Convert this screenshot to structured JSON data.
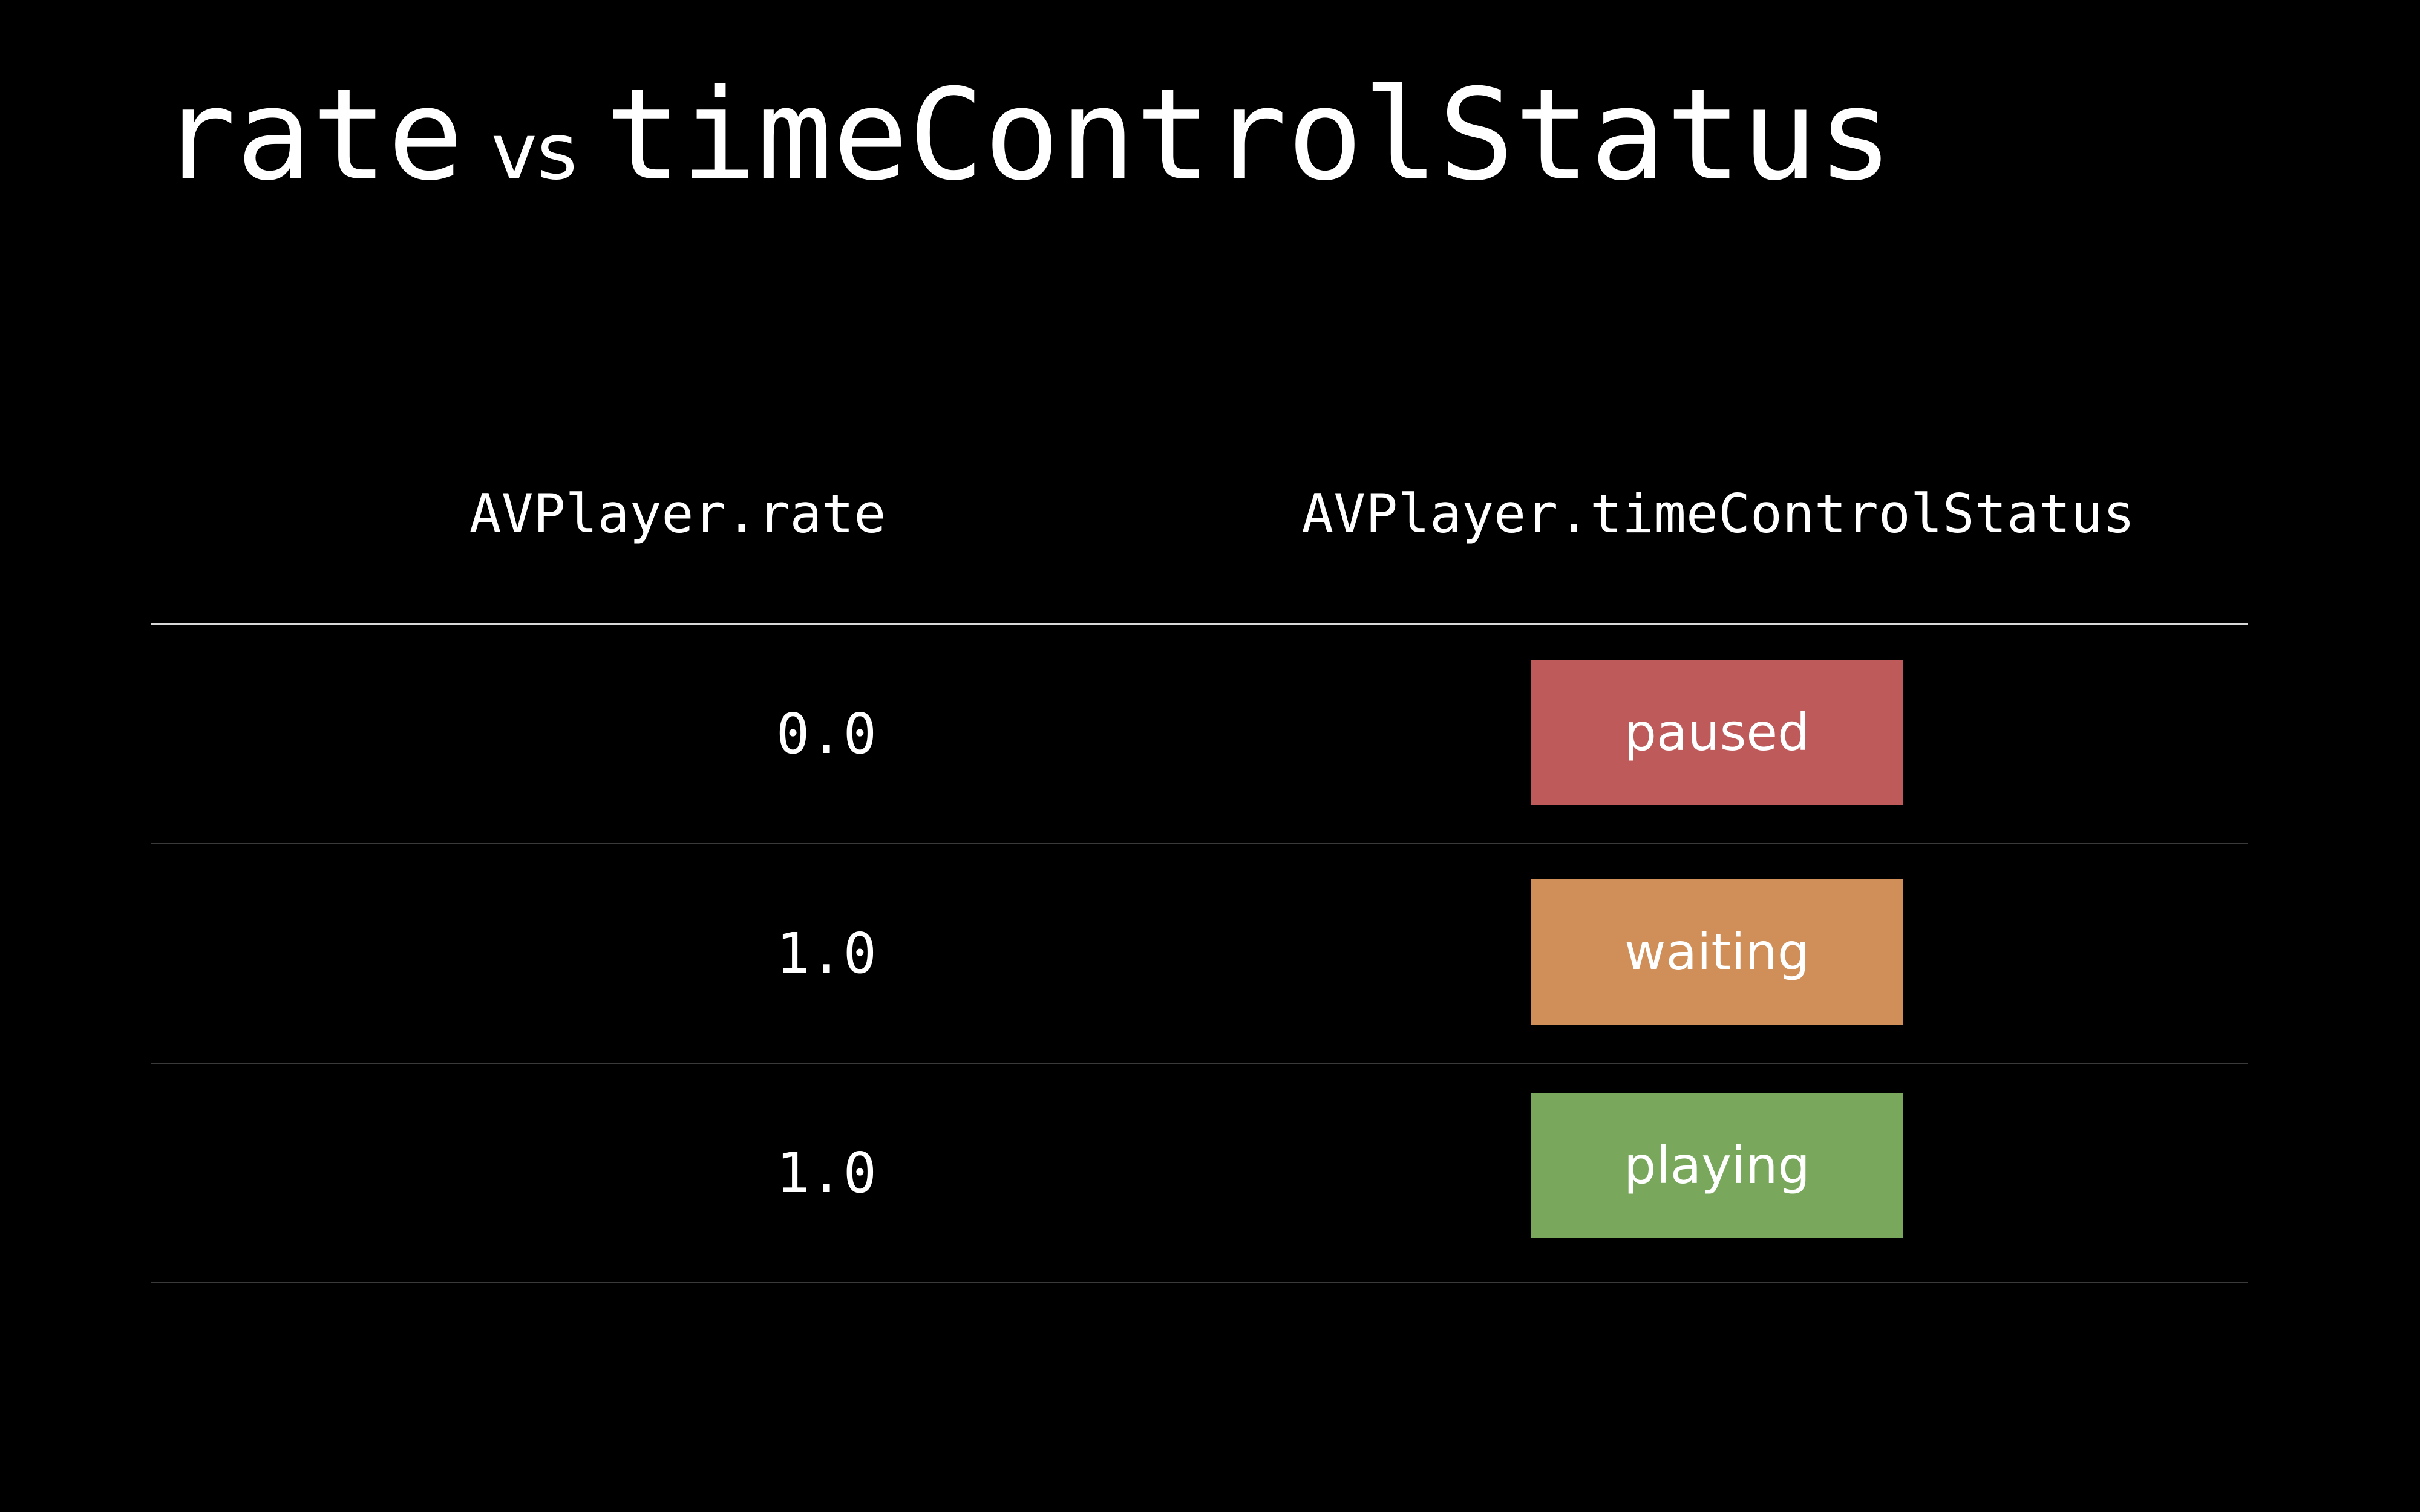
{
  "title": {
    "left": "rate",
    "middle": "vs",
    "right": "timeControlStatus"
  },
  "table": {
    "headers": {
      "rate": "AVPlayer.rate",
      "status": "AVPlayer.timeControlStatus"
    },
    "rows": [
      {
        "rate": "0.0",
        "status": "paused",
        "status_color": "#bf5a5b"
      },
      {
        "rate": "1.0",
        "status": "waiting",
        "status_color": "#d08f58"
      },
      {
        "rate": "1.0",
        "status": "playing",
        "status_color": "#79a85c"
      }
    ]
  }
}
